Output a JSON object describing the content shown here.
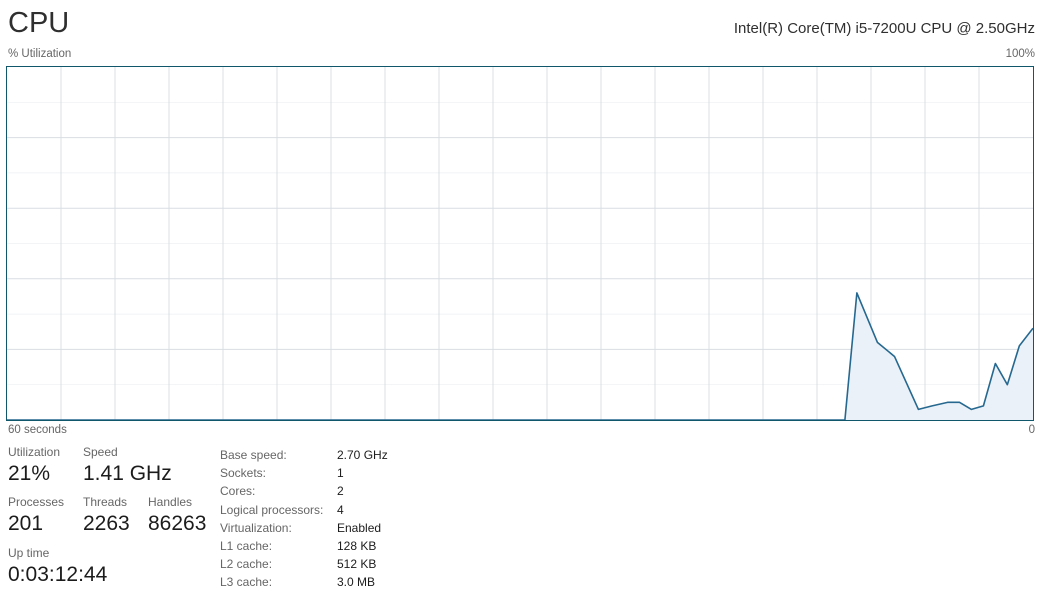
{
  "header": {
    "title": "CPU",
    "cpu_model": "Intel(R) Core(TM) i5-7200U CPU @ 2.50GHz"
  },
  "graph": {
    "y_axis_label": "% Utilization",
    "y_axis_max": "100%",
    "x_axis_left": "60 seconds",
    "x_axis_right": "0",
    "line_color": "#26688f",
    "fill_color": "#eaf1f8",
    "border_color": "#11576b",
    "grid_color": "#d8dde1"
  },
  "stats": {
    "utilization": {
      "label": "Utilization",
      "value": "21%"
    },
    "speed": {
      "label": "Speed",
      "value": "1.41 GHz"
    },
    "processes": {
      "label": "Processes",
      "value": "201"
    },
    "threads": {
      "label": "Threads",
      "value": "2263"
    },
    "handles": {
      "label": "Handles",
      "value": "86263"
    },
    "uptime": {
      "label": "Up time",
      "value": "0:03:12:44"
    }
  },
  "specs": [
    {
      "key": "Base speed:",
      "value": "2.70 GHz"
    },
    {
      "key": "Sockets:",
      "value": "1"
    },
    {
      "key": "Cores:",
      "value": "2"
    },
    {
      "key": "Logical processors:",
      "value": "4"
    },
    {
      "key": "Virtualization:",
      "value": "Enabled"
    },
    {
      "key": "L1 cache:",
      "value": "128 KB"
    },
    {
      "key": "L2 cache:",
      "value": "512 KB"
    },
    {
      "key": "L3 cache:",
      "value": "3.0 MB"
    }
  ],
  "chart_data": {
    "type": "area",
    "title": "CPU % Utilization over 60 seconds",
    "xlabel": "60 seconds",
    "ylabel": "% Utilization",
    "xlim": [
      0,
      60
    ],
    "ylim": [
      0,
      100
    ],
    "grid": true,
    "grid_rows": 10,
    "grid_cols": 19,
    "legend": "none",
    "series": [
      {
        "name": "% Utilization",
        "x": [
          0,
          49.0,
          49.7,
          50.9,
          51.9,
          53.3,
          54.1,
          55.0,
          55.7,
          56.4,
          57.1,
          57.8,
          58.5,
          59.2,
          60.0
        ],
        "values": [
          0,
          0,
          36,
          22,
          18,
          3,
          4,
          5,
          5,
          3,
          4,
          16,
          10,
          21,
          26
        ]
      }
    ]
  }
}
